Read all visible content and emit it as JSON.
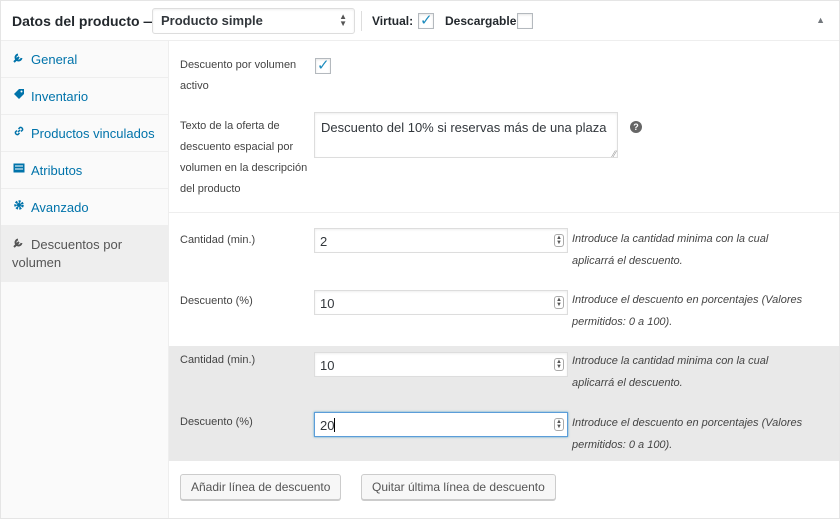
{
  "header": {
    "title": "Datos del producto —",
    "product_type": "Producto simple",
    "virtual_label": "Virtual:",
    "virtual_checked": true,
    "downloadable_label": "Descargable:",
    "downloadable_checked": false,
    "arrows": "▲\n▼",
    "collapse_glyph": "▲"
  },
  "sidebar": {
    "items": [
      {
        "label": "General",
        "icon": "wrench-icon",
        "glyph": "🔧"
      },
      {
        "label": "Inventario",
        "icon": "tag-icon",
        "glyph": "◆"
      },
      {
        "label": "Productos vinculados",
        "icon": "link-icon",
        "glyph": "🔗"
      },
      {
        "label": "Atributos",
        "icon": "list-icon",
        "glyph": "▤"
      },
      {
        "label": "Avanzado",
        "icon": "gear-icon",
        "glyph": "✲"
      },
      {
        "label": "Descuentos por volumen",
        "icon": "wrench-icon",
        "glyph": "🔧",
        "active": true
      }
    ]
  },
  "main": {
    "volume_discount_label": "Descuento por volumen activo",
    "volume_discount_checked": true,
    "offer_text_label": "Texto de la oferta de descuento espacial por volumen en la descripción del producto",
    "offer_text_value": "Descuento del 10% si reservas más de una plaza",
    "help_glyph": "?",
    "grip_glyph": "⁄⁄",
    "spin_glyph": "▲▼",
    "tick_glyph": "✓",
    "discount_rows": [
      {
        "qty_label": "Cantidad (min.)",
        "qty_value": "2",
        "qty_desc": "Introduce la cantidad minima con la cual aplicarrá el descuento.",
        "pct_label": "Descuento (%)",
        "pct_value": "10",
        "pct_desc": "Introduce el descuento en porcentajes (Valores permitidos: 0 a 100)."
      },
      {
        "qty_label": "Cantidad (min.)",
        "qty_value": "10",
        "qty_desc": "Introduce la cantidad minima con la cual aplicarrá el descuento.",
        "pct_label": "Descuento (%)",
        "pct_value": "20",
        "pct_desc": "Introduce el descuento en porcentajes (Valores permitidos: 0 a 100)."
      }
    ],
    "add_button": "Añadir línea de descuento",
    "remove_button": "Quitar última línea de descuento"
  },
  "colors": {
    "link": "#0073aa",
    "checkmark": "#1e8cbe",
    "focus": "#5b9dd9"
  }
}
